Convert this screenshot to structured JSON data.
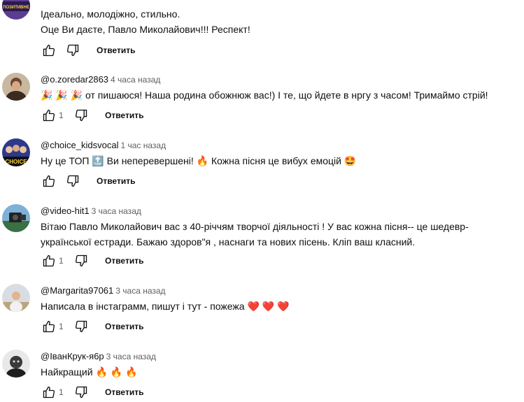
{
  "comments": [
    {
      "author": "",
      "time": "",
      "avatar_text": "ПОЗИТИВНЕ",
      "lines": [
        "Ідеально, молодіжно, стильно.",
        "Оце Ви даєте, Павло Миколайович!!! Респект!"
      ],
      "likes": "",
      "reply": "Ответить"
    },
    {
      "author": "@o.zoredar2863",
      "time": "4 часа назад",
      "text_parts": {
        "emoji1": "🎉",
        "emoji2": "🎉",
        "emoji3": "🎉",
        "body": "от пишаюся! Наша родина обожнюж вас!) І те, що йдете в нргу з часом! Тримаймо стрій!"
      },
      "likes": "1",
      "reply": "Ответить"
    },
    {
      "author": "@choice_kidsvocal",
      "time": "1 час назад",
      "avatar_text": "CHOICE",
      "text_parts": {
        "p1": "Ну це ТОП",
        "top": "🔝",
        "p2": "Ви неперевершені!",
        "fire": "🔥",
        "p3": "Кожна пісня це вибух емоцій",
        "star": "🤩"
      },
      "likes": "",
      "reply": "Ответить"
    },
    {
      "author": "@video-hit1",
      "time": "3 часа назад",
      "lines": [
        "Вітаю Павло  Миколайович вас з 40-річчям творчої діяльності ! У вас кожна пісня-- це шедевр-",
        "української естради. Бажаю здоров\"я , наснаги та нових пісень. Кліп ваш  класний."
      ],
      "likes": "1",
      "reply": "Ответить"
    },
    {
      "author": "@Margarita97061",
      "time": "3 часа назад",
      "text_parts": {
        "body": "Написала в інстаграмм, пишут і тут - пожежа",
        "h1": "❤️",
        "h2": "❤️",
        "h3": "❤️"
      },
      "likes": "1",
      "reply": "Ответить"
    },
    {
      "author": "@ІванКрук-я6р",
      "time": "3 часа назад",
      "text_parts": {
        "body": "Найкращий",
        "f1": "🔥",
        "f2": "🔥",
        "f3": "🔥"
      },
      "likes": "1",
      "reply": "Ответить"
    }
  ],
  "icons": {
    "like": "thumbs-up-icon",
    "dislike": "thumbs-down-icon"
  },
  "colors": {
    "secondary_text": "#606060",
    "text": "#0f0f0f",
    "heart": "#e0245e",
    "fire": "#f4900c"
  }
}
